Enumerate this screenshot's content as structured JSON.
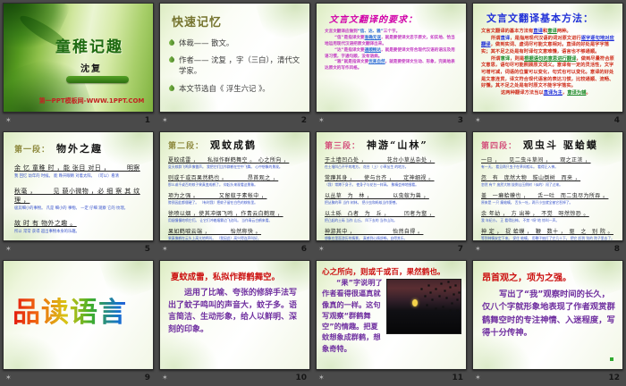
{
  "chrome": {
    "animation_star_icon": "✶"
  },
  "colors": {
    "board_background": "#4a4a4a",
    "cover_title_green": "#1f6b12",
    "quote_red": "#cc1111",
    "analysis_purple": "#7030a0",
    "translation_red": "#d0301e",
    "translation_blue": "#2030d8",
    "requirement_magenta": "#d100a8",
    "note_blue": "#3a55cc",
    "ppt_url_red": "#c32222"
  },
  "slides": [
    {
      "number": "1",
      "title": "童稚记趣",
      "author": "沈复",
      "footer_url": "第一PPT模板网-WWW.1PPT.COM"
    },
    {
      "number": "2",
      "title": "快速记忆",
      "bullets": [
        "体裁—— 散文。",
        "作者—— 沈复 ，字（三白），清代文学家。",
        "本文节选自《 浮生六记 》。"
      ]
    },
    {
      "number": "3",
      "title": "文言文翻译的要求：",
      "paragraphs": [
        [
          {
            "t": "文言文翻译应做到",
            "c": "#c23ac2"
          },
          {
            "t": "“信、达、雅”",
            "c": "#2a6ad4"
          },
          {
            "t": "三个字。",
            "c": "#c23ac2"
          }
        ],
        [
          {
            "t": "“信”是指译文要",
            "c": "#c23ac2"
          },
          {
            "t": "准确无误",
            "c": "#2a6ad4",
            "u": true
          },
          {
            "t": "，就是要使译文忠于原文，如实地、恰当地运用现代汉语把原文翻译出来。",
            "c": "#c23ac2"
          }
        ],
        [
          {
            "t": "“达”是指译文要",
            "c": "#c23ac2"
          },
          {
            "t": "通顺畅达",
            "c": "#2a6ad4",
            "u": true
          },
          {
            "t": "，就是要使译文符合现代汉语的语法及用语习惯，字通句顺，没有语病。",
            "c": "#c23ac2"
          }
        ],
        [
          {
            "t": "“雅”就是指译文要",
            "c": "#c23ac2"
          },
          {
            "t": "优美自然",
            "c": "#2a6ad4",
            "u": true
          },
          {
            "t": "，就是要使译文生动、形象，完美地表达原文的写作风格。",
            "c": "#c23ac2"
          }
        ]
      ]
    },
    {
      "number": "4",
      "title": "文言文翻译基本方法：",
      "paragraphs": [
        [
          {
            "t": "文言文翻译的基本方法有",
            "c": "#d0301e"
          },
          {
            "t": "直译",
            "c": "#2030d8",
            "u": true
          },
          {
            "t": "和",
            "c": "#d0301e"
          },
          {
            "t": "意译",
            "c": "#1e8a2a",
            "u": true
          },
          {
            "t": "两种。",
            "c": "#d0301e"
          }
        ],
        [
          {
            "t": "所谓",
            "c": "#d0301e"
          },
          {
            "t": "直译",
            "c": "#2030d8"
          },
          {
            "t": "，是指用现代汉语的词对原文进行",
            "c": "#d0301e"
          },
          {
            "t": "逐字逐句地对应翻译",
            "c": "#2030d8",
            "u": true
          },
          {
            "t": "，做到实词、虚词尽可能文意相对。直译的好处是字字落实；其不足之处是有时译句文意难懂，语言也不够通顺。",
            "c": "#d0301e"
          }
        ],
        [
          {
            "t": "所谓",
            "c": "#d0301e"
          },
          {
            "t": "意译",
            "c": "#1e8a2a"
          },
          {
            "t": "，则是",
            "c": "#d0301e"
          },
          {
            "t": "根据语句的意思进行翻译",
            "c": "#1e8a2a",
            "u": true
          },
          {
            "t": "，做到尽量符合原文意思，语句尽可能照顾原文词义。意译有一定的灵活性，文字可增可减，词语的位置可以变化，句式也可以变化。意译的好处是文意连贯，译文符合现代语言的表达习惯，比较通顺、流畅、好懂。其不足之处是有时原文不能字字落实。",
            "c": "#d0301e"
          }
        ],
        [
          {
            "t": "这两种翻译方法当以",
            "c": "#d0301e"
          },
          {
            "t": "直译为主",
            "c": "#2030d8",
            "u": true
          },
          {
            "t": "，",
            "c": "#d0301e"
          },
          {
            "t": "意译为辅",
            "c": "#1e8a2a",
            "u": true
          },
          {
            "t": "。",
            "c": "#d0301e"
          }
        ]
      ]
    },
    {
      "number": "5",
      "section": "第一段：",
      "title": "物外之趣",
      "lines": [
        {
          "text": "余 忆 童稚 时 ，能 张目 对日 ，　　　明察",
          "note": "我 回忆 幼年的 时候。 能 睁开眼睛 对着太阳。 （可以）看清"
        },
        {
          "text": "秋毫 ，　　　见 藐小微物 ，必 细 察 其 纹理 ，",
          "note": "极其细小的事物。 凡是 细小的 事物。 一定 仔细 观察 它的 纹理。"
        },
        {
          "text": "故 时 有 物外之趣 。",
          "note": "所以 常常 获得 超出事物本身的乐趣。"
        }
      ]
    },
    {
      "number": "6",
      "section": "第二段：",
      "title": "观蚊成鹤",
      "lines": [
        {
          "text": "夏蚊成雷 ，　　私拟作群鹤舞空 。　心之所向 ，",
          "note": "夏天蚊群飞鸣声像雷声。 我把它们比作群鹤在空中飞舞。 心中想象的景观。"
        },
        {
          "text": "则或千或百果然鹤也 。　　　　昂首观之 ，",
          "note": "那么或千或百的蚊子果真变成鹤了。 仰起头来观看这景象。"
        },
        {
          "text": "项为之强 。　　　　又留蚊于素帐中 ，",
          "note": "脖颈因此都僵硬了。 （有时我）把蚊子留在白色的蚊帐里。"
        },
        {
          "text": "徐喷以烟 ，使其冲烟飞鸣 ，作青云白鹤观 ，",
          "note": "用烟慢慢地喷它们。 让它们冲着烟雾边飞边叫。 当作青云白鹤来看。"
        },
        {
          "text": "果如鹤唳云端 ，　　　　怡然称快 。",
          "note": "果真像鹤在云头上高亢地鸣叫。 （我因此）高兴得连声叫好。"
        }
      ]
    },
    {
      "number": "7",
      "section": "第三段：",
      "title": "神游“山林”",
      "lines": [
        {
          "text": "于土墙凹凸处 ，　　　　花台小草丛杂处 ，",
          "note": "在土墙凹凸不平的地方。 花台（上）小草丛生 的地方。"
        },
        {
          "text": "常蹲其身 ，　　使与台齐 ，　　定神细视 。",
          "note": "（我）常蹲下身子。 使身子与花台一样高。 聚精会神地细看。"
        },
        {
          "text": "以丛草　为　林 ，　　　　以虫蚁为兽 ，",
          "note": "把丛聚的草 当作 树林。 把小虫和蚂蚁当作野兽。"
        },
        {
          "text": "以土砾　凸者　为　丘 ，　　　凹者为壑 ，",
          "note": "把凸起的土砾 当作 山丘。 凹下去的 当作山沟。"
        },
        {
          "text": "神游其中 ，　　　　　　　怡然自得 。",
          "note": "想象在里面游历的情景。 真感到心情舒畅，自得其乐。"
        }
      ]
    },
    {
      "number": "8",
      "section": "第四段：",
      "title": "观虫斗 驱蛤蟆",
      "lines": [
        {
          "text": "一日 ，　　见二虫斗草间 ，　　观之正浓 ，",
          "note": "有一天。 看见两只虫子在草间相斗。 看得正入神。"
        },
        {
          "text": "忽　有　庞然大物　拔山倒树　而来 ，",
          "note": "忽然 有个 庞然大物 拔倒山压倒树（似的）闯了过来。"
        },
        {
          "text": "盖　一癞蛤蟆也 ，　　舌一吐　而二虫尽为所吞 。",
          "note": "原来是 一只 癞蛤蟆。 舌头一吐，两只小虫就全被它吞掉了。"
        },
        {
          "text": "余 年幼 ，　方 出神 ，　不觉　呀然惊恐 。",
          "note": "我 年纪小。 正 看得出神。 不禁 “呀”地 惊叫一声。"
        },
        {
          "text": "神 定 ，　捉 蛤蟆 ，　鞭　数十 ，　驱　之　别 院 。",
          "note": "等到神情安定下来。 捉住 蛤蟆。 用鞭子抽打了它几十下。 把它 赶到 别的 院子里去了。"
        }
      ]
    },
    {
      "number": "9",
      "wordart": "品读语言"
    },
    {
      "number": "10",
      "quote": "夏蚊成雷，私拟作群鹤舞空。",
      "analysis": "运用了比喻、夸张的修辞手法写出了蚊子鸣叫的声音大，蚊子多。语言简洁、生动形象，给人以鲜明、深刻的印象。"
    },
    {
      "number": "11",
      "quote": "心之所向，则或千或百，果然鹤也。",
      "analysis": "“果”字说明了作者看得很逼真就像真的一样。这句写观察“群鹤舞空”的情趣。把夏蚊想象成群鹤，想象奇特。",
      "image": "night-sky-flock-of-birds-with-moon"
    },
    {
      "number": "12",
      "quote": "昂首观之，项为之强。",
      "analysis": "写出了“我”观察时间的长久，仅八个字就形象地表现了作者观赏群鹤舞空时的专注神情、入迷程度，写得十分传神。"
    }
  ]
}
